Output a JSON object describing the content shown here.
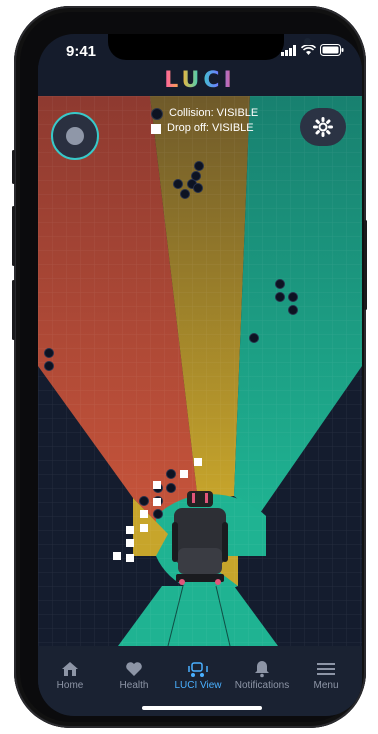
{
  "status": {
    "time": "9:41"
  },
  "app": {
    "logo": "LUCI"
  },
  "legend": {
    "collision": "Collision: VISIBLE",
    "dropoff": "Drop off: VISIBLE"
  },
  "tabs": [
    {
      "label": "Home",
      "icon": "home-icon"
    },
    {
      "label": "Health",
      "icon": "heart-icon"
    },
    {
      "label": "LUCI View",
      "icon": "wheelchair-icon"
    },
    {
      "label": "Notifications",
      "icon": "bell-icon"
    },
    {
      "label": "Menu",
      "icon": "menu-icon"
    }
  ],
  "colors": {
    "accent": "#4ab0ff",
    "zone_red": "#c8553b",
    "zone_yellow": "#c7a52b",
    "zone_green": "#1fb392",
    "background": "#141c2e"
  }
}
